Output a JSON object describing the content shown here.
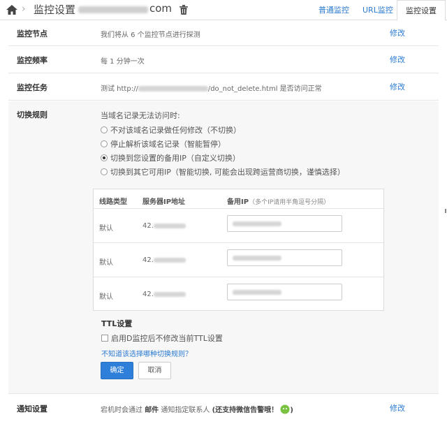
{
  "header": {
    "title": "监控设置",
    "domain_suffix": "com",
    "tabs": [
      "普通监控",
      "URL监控",
      "监控设置"
    ]
  },
  "rows": {
    "node": {
      "label": "监控节点",
      "text": "我们将从 6 个监控节点进行探测",
      "edit": "修改"
    },
    "freq": {
      "label": "监控频率",
      "text": "每 1 分钟一次",
      "edit": "修改"
    },
    "task": {
      "label": "监控任务",
      "text_prefix": "测试 http://",
      "text_path": "/do_not_delete.html 是否访问正常",
      "edit": "修改"
    },
    "switch": {
      "label": "切换规则",
      "intro": "当域名记录无法访问时:",
      "options": [
        "不对该域名记录做任何修改（不切换）",
        "停止解析该域名记录（智能暂停）",
        "切换到您设置的备用IP（自定义切换）",
        "切换到其它可用IP（智能切换, 可能会出现跨运营商切换，谨慎选择）"
      ],
      "selected_index": 2
    },
    "notify": {
      "label": "通知设置",
      "text_a": "宕机时会通过 ",
      "text_mail": "邮件",
      "text_b": " 通知指定联系人",
      "text_c": "(还支持微信告警哦！",
      "text_d": ")",
      "edit": "修改"
    }
  },
  "table": {
    "headers": {
      "line": "线路类型",
      "server": "服务器IP地址",
      "backup": "备用IP",
      "backup_hint": "（多个IP请用半角逗号分隔）"
    },
    "rows": [
      {
        "line": "默认",
        "server_prefix": "42."
      },
      {
        "line": "默认",
        "server_prefix": "42."
      },
      {
        "line": "默认",
        "server_prefix": "42."
      }
    ]
  },
  "ttl": {
    "title": "TTL设置",
    "option": "启用D监控后不修改当前TTL设置",
    "help": "不知道该选择哪种切换规则？"
  },
  "buttons": {
    "ok": "确定",
    "cancel": "取消"
  },
  "colors": {
    "link": "#2a7ad2",
    "primary": "#2d7fd9",
    "panel": "#f7f7f7"
  },
  "icons": [
    "home-icon",
    "trash-icon",
    "wechat-icon"
  ]
}
